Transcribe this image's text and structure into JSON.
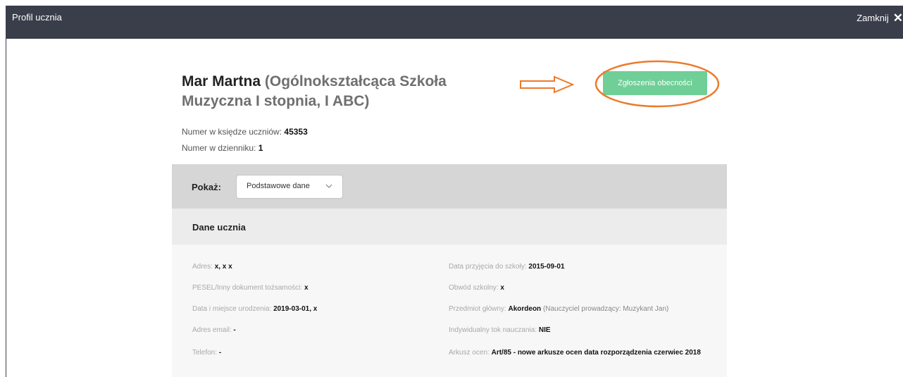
{
  "window": {
    "title": "Profil ucznia",
    "close_label": "Zamknij"
  },
  "student": {
    "name": "Mar Martna",
    "school_info": "(Ogólnokształcąca Szkoła Muzyczna I stopnia, I ABC)",
    "book_number_label": "Numer w księdze uczniów:",
    "book_number": "45353",
    "journal_number_label": "Numer w dzienniku:",
    "journal_number": "1"
  },
  "attendance_button": {
    "label": "Zgłoszenia obecności",
    "color": "#6fcf97"
  },
  "annotation": {
    "color": "#ec7a2b"
  },
  "filter": {
    "label": "Pokaż:",
    "selected": "Podstawowe dane"
  },
  "section": {
    "title": "Dane ucznia"
  },
  "fields": {
    "address": {
      "label": "Adres:",
      "value": "x, x x"
    },
    "pesel": {
      "label": "PESEL/Inny dokument tożsamości:",
      "value": "x"
    },
    "birth": {
      "label": "Data i miejsce urodzenia:",
      "value": "2019-03-01, x"
    },
    "email": {
      "label": "Adres email:",
      "value": "-"
    },
    "phone": {
      "label": "Telefon:",
      "value": "-"
    },
    "admission": {
      "label": "Data przyjęcia do szkoły:",
      "value": "2015-09-01"
    },
    "district": {
      "label": "Obwód szkolny:",
      "value": "x"
    },
    "main_subject": {
      "label": "Przedmiot główny:",
      "value": "Akordeon",
      "teacher": "(Nauczyciel prowadzący: Muzykant Jan)"
    },
    "individual": {
      "label": "Indywidualny tok nauczania:",
      "value": "NIE"
    },
    "grade_sheet": {
      "label": "Arkusz ocen:",
      "value": "Art/85 - nowe arkusze ocen data rozporządzenia czerwiec 2018"
    }
  }
}
